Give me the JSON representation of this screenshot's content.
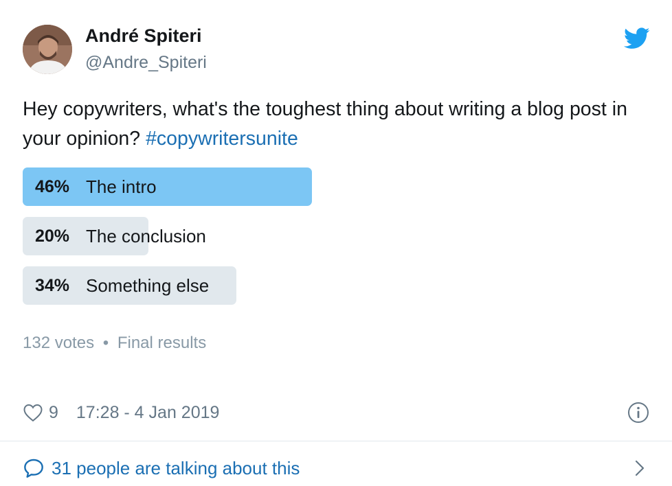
{
  "author": {
    "name": "André Spiteri",
    "handle": "@Andre_Spiteri",
    "avatar_icon": "user-avatar"
  },
  "brand_icon": "twitter-bird-icon",
  "colors": {
    "brand_blue": "#1da1f2",
    "link_blue": "#1b6fb3",
    "winner_bar": "#7cc6f4",
    "bar": "#e1e8ed",
    "muted": "#657786"
  },
  "tweet": {
    "text": "Hey copywriters, what's the toughest thing about writing a blog post in your opinion?",
    "hashtag": "#copywritersunite"
  },
  "poll": {
    "options": [
      {
        "percent_label": "46%",
        "label": "The intro",
        "fraction": 0.46,
        "winner": true
      },
      {
        "percent_label": "20%",
        "label": "The conclusion",
        "fraction": 0.2,
        "winner": false
      },
      {
        "percent_label": "34%",
        "label": "Something else",
        "fraction": 0.34,
        "winner": false
      }
    ],
    "votes": "132 votes",
    "separator": "•",
    "status": "Final results"
  },
  "footer": {
    "likes": "9",
    "timestamp": "17:28 - 4 Jan 2019",
    "talking": "31 people are talking about this"
  }
}
